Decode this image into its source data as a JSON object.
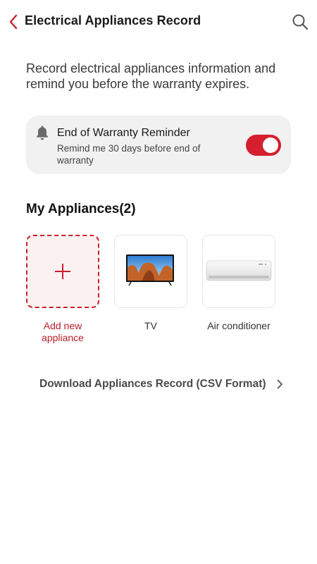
{
  "header": {
    "title": "Electrical Appliances Record",
    "back_icon": "chevron-left-icon",
    "search_icon": "search-icon"
  },
  "description": "Record electrical appliances information and remind you before the warranty expires.",
  "reminder": {
    "icon": "bell-icon",
    "title": "End of Warranty Reminder",
    "subtitle": "Remind me 30 days before end of warranty",
    "enabled": true
  },
  "appliances": {
    "title": "My Appliances(2)",
    "add_label": "Add new appliance",
    "items": [
      {
        "label": "TV",
        "icon": "tv-image"
      },
      {
        "label": "Air conditioner",
        "icon": "air-conditioner-image"
      }
    ]
  },
  "download": {
    "label": "Download Appliances Record (CSV Format)",
    "icon": "chevron-right-icon"
  },
  "colors": {
    "accent": "#d51f2e",
    "card_bg": "#f1f1f1",
    "add_tile_bg": "#fcf1f1"
  }
}
